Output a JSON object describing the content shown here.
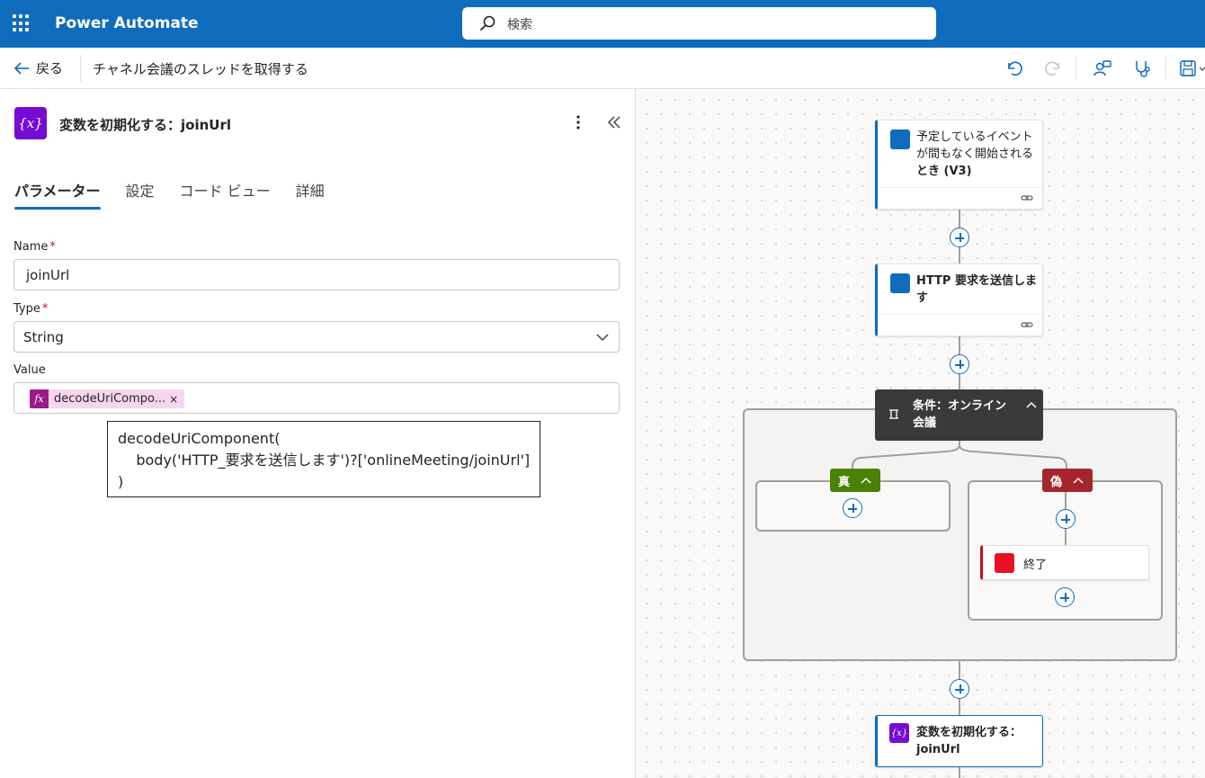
{
  "app": {
    "name": "Power Automate"
  },
  "search": {
    "placeholder": "検索"
  },
  "commandbar": {
    "back_label": "戻る",
    "flow_title": "チャネル会議のスレッドを取得する"
  },
  "panel": {
    "title": "変数を初期化する：joinUrl",
    "icon_text": "{x}",
    "tabs": [
      "パラメーター",
      "設定",
      "コード ビュー",
      "詳細"
    ],
    "active_tab": "パラメーター",
    "fields": {
      "name": {
        "label": "Name",
        "required_mark": "*",
        "value": "joinUrl"
      },
      "type": {
        "label": "Type",
        "required_mark": "*",
        "value": "String"
      },
      "value": {
        "label": "Value",
        "token_icon": "fx",
        "token_text": "decodeUriCompo...",
        "token_remove": "×"
      }
    },
    "expression_tooltip": [
      "decodeUriComponent(",
      "    body('HTTP_要求を送信します')?['onlineMeeting/joinUrl']",
      ")"
    ]
  },
  "flow": {
    "trigger": {
      "label_lines": [
        "予定しているイベント",
        "が間もなく開始される",
        "とき (V3)"
      ]
    },
    "http": {
      "label_lines": [
        "HTTP 要求を送信しま",
        "す"
      ]
    },
    "condition": {
      "label_lines": [
        "条件：オンライン",
        "会議"
      ],
      "true_label": "真",
      "false_label": "偽"
    },
    "terminate": {
      "label": "終了"
    },
    "init_var": {
      "label_lines": [
        "変数を初期化する：",
        "joinUrl"
      ],
      "icon_text": "{x}"
    }
  },
  "colors": {
    "header_blue": "#0f6cbd",
    "variable_purple": "#770bd6",
    "true_green": "#498205",
    "false_red": "#a4262c",
    "condition_dark": "#3b3a39"
  }
}
